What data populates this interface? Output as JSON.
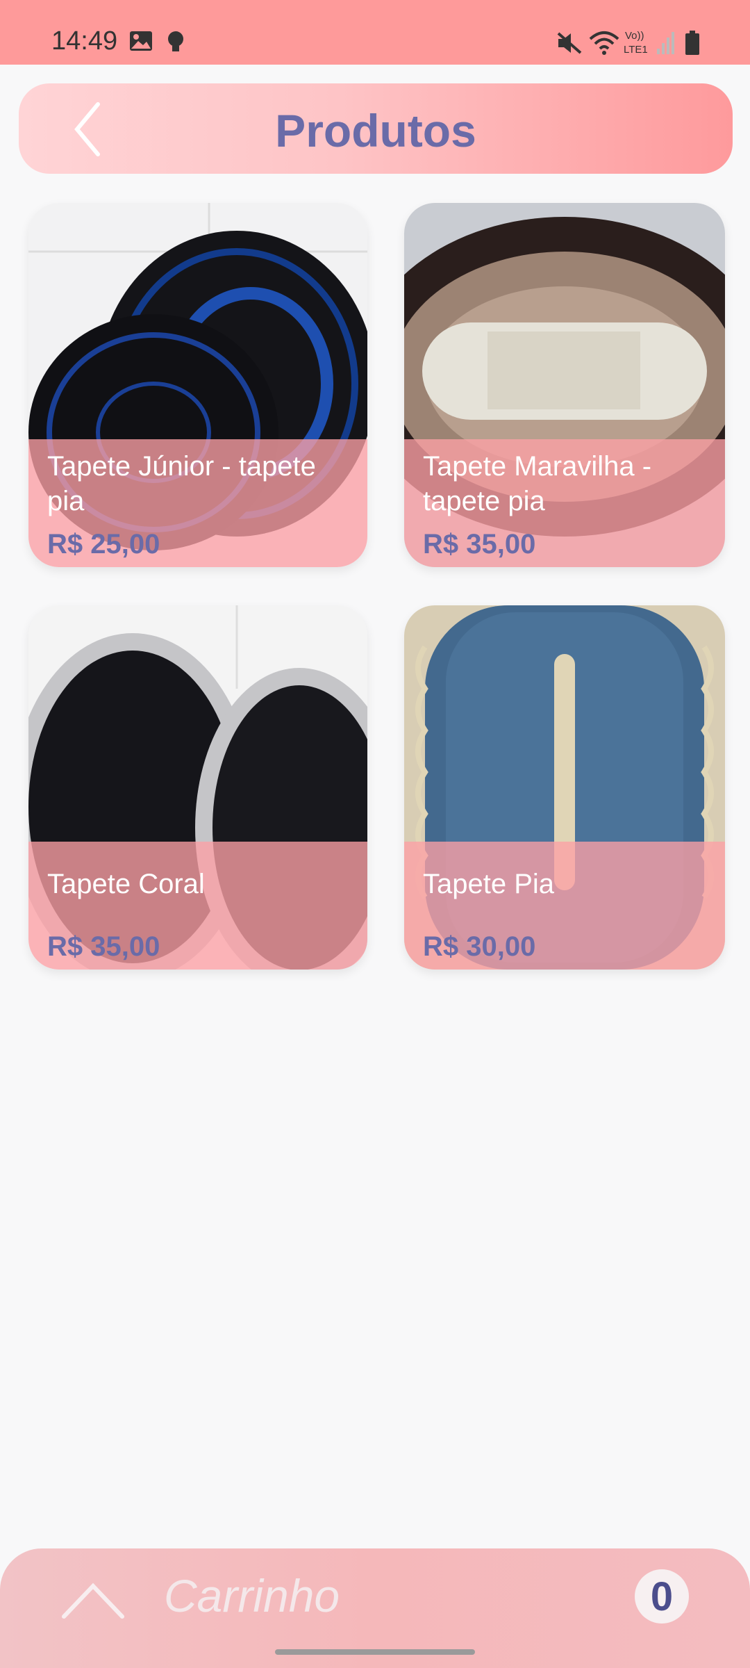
{
  "status": {
    "time": "14:49"
  },
  "header": {
    "title": "Produtos"
  },
  "products": [
    {
      "name": "Tapete Júnior - tapete pia",
      "price": "R$ 25,00"
    },
    {
      "name": "Tapete Maravilha - tapete pia",
      "price": "R$ 35,00"
    },
    {
      "name": "Tapete Coral",
      "price": "R$ 35,00"
    },
    {
      "name": "Tapete Pia",
      "price": "R$ 30,00"
    }
  ],
  "cart": {
    "label": "Carrinho",
    "count": "0"
  },
  "colors": {
    "accent": "#6a6ba8",
    "brand": "#fe9a9a",
    "card_overlay": "#fca0a5"
  },
  "icons": [
    "photo-icon",
    "bulb-icon",
    "mute-icon",
    "wifi-icon",
    "volte-icon",
    "signal-icon",
    "battery-icon",
    "back-chevron-icon",
    "chevron-up-icon"
  ]
}
